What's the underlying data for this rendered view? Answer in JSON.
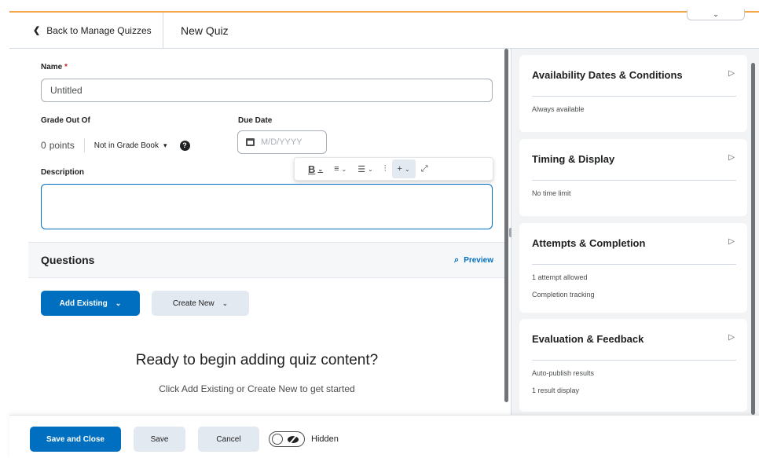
{
  "colors": {
    "accent": "#f1a545",
    "primary": "#006fbf",
    "secondary_bg": "#e3e9f1",
    "side_bg": "#f1f3f5"
  },
  "header": {
    "back_label": "Back to Manage Quizzes",
    "title": "New Quiz",
    "collapse_icon": "chevron-down-icon"
  },
  "form": {
    "name_label": "Name",
    "name_required": "*",
    "name_value": "Untitled",
    "grade_label": "Grade Out Of",
    "points_value": "0",
    "points_unit": "points",
    "gradebook_value": "Not in Grade Book",
    "help_icon": "?",
    "due_label": "Due Date",
    "due_placeholder": "M/D/YYYY",
    "description_label": "Description",
    "toolbar": {
      "bold": "B",
      "align": "≡",
      "list": "☰",
      "insert": "+",
      "expand": "⤢"
    }
  },
  "questions": {
    "title": "Questions",
    "preview_label": "Preview",
    "add_existing_label": "Add Existing",
    "create_new_label": "Create New",
    "empty_title": "Ready to begin adding quiz content?",
    "empty_subtitle": "Click Add Existing or Create New to get started"
  },
  "side": {
    "cards": [
      {
        "title": "Availability Dates & Conditions",
        "lines": [
          "Always available"
        ]
      },
      {
        "title": "Timing & Display",
        "lines": [
          "No time limit"
        ]
      },
      {
        "title": "Attempts & Completion",
        "lines": [
          "1 attempt allowed",
          "Completion tracking"
        ]
      },
      {
        "title": "Evaluation & Feedback",
        "lines": [
          "Auto-publish results",
          "1 result display"
        ]
      }
    ]
  },
  "footer": {
    "save_close_label": "Save and Close",
    "save_label": "Save",
    "cancel_label": "Cancel",
    "visibility_label": "Hidden"
  }
}
